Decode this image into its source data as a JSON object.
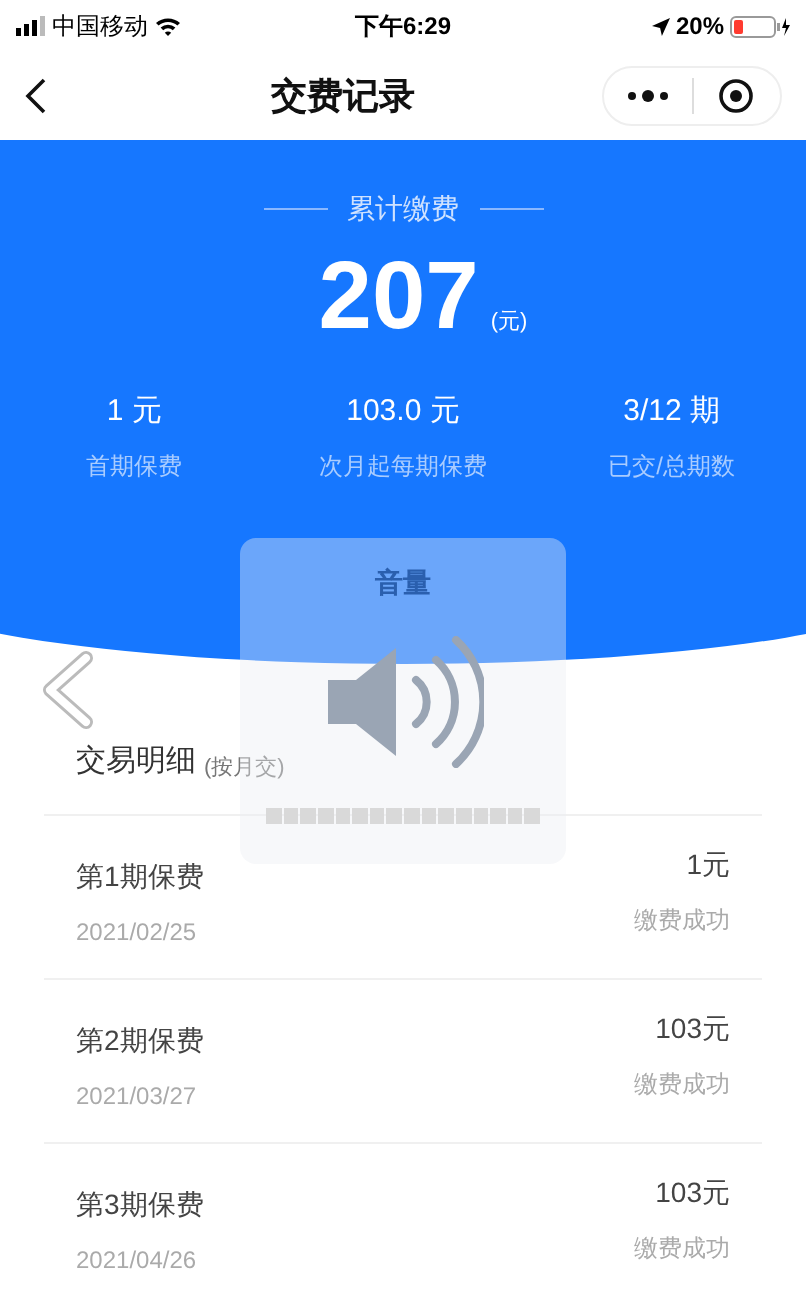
{
  "status_bar": {
    "carrier": "中国移动",
    "time": "下午6:29",
    "battery": "20%"
  },
  "nav": {
    "title": "交费记录"
  },
  "summary": {
    "label": "累计缴费",
    "amount": "207",
    "unit": "(元)"
  },
  "stats": [
    {
      "value": "1 元",
      "label": "首期保费"
    },
    {
      "value": "103.0 元",
      "label": "次月起每期保费"
    },
    {
      "value": "3/12 期",
      "label": "已交/总期数"
    }
  ],
  "volume_hud": {
    "title": "音量",
    "level": 0
  },
  "details": {
    "title": "交易明细",
    "note": "(按月交)",
    "rows": [
      {
        "name": "第1期保费",
        "date": "2021/02/25",
        "amount": "1元",
        "status": "缴费成功"
      },
      {
        "name": "第2期保费",
        "date": "2021/03/27",
        "amount": "103元",
        "status": "缴费成功"
      },
      {
        "name": "第3期保费",
        "date": "2021/04/26",
        "amount": "103元",
        "status": "缴费成功"
      }
    ]
  }
}
